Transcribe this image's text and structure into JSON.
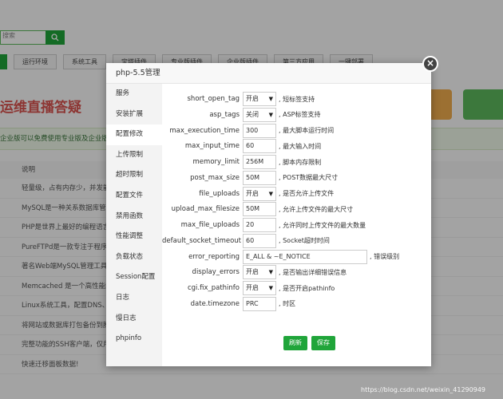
{
  "background": {
    "search_placeholder": "搜索",
    "tabs": [
      "运行环境",
      "系统工具",
      "宝塔插件",
      "专业版插件",
      "企业版插件",
      "第三方应用",
      "一键部署"
    ],
    "banner_text": "运维直播答疑",
    "notice": "企业版可以免费使用专业版及企业版插",
    "list_header": "说明",
    "list_rows": [
      "轻量级，占有内存少，并发能力",
      "MySQL是一种关系数据库管理",
      "PHP是世界上最好的编程语言",
      "PureFTPd是一款专注于程序健",
      "著名Web端MySQL管理工具",
      "Memcached 是一个高性能的分",
      "Linux系统工具，配置DNS、Sw",
      "将网站或数据库打包备份到腾讯",
      "完整功能的SSH客户端，仅用于",
      "快速迁移面板数据!"
    ]
  },
  "dialog": {
    "title": "php-5.5管理",
    "close": "×",
    "sidebar": [
      "服务",
      "安装扩展",
      "配置修改",
      "上传限制",
      "超时限制",
      "配置文件",
      "禁用函数",
      "性能调整",
      "负载状态",
      "Session配置",
      "日志",
      "慢日志",
      "phpinfo"
    ],
    "active_index": 2,
    "rows": [
      {
        "label": "short_open_tag",
        "type": "select",
        "value": "开启",
        "desc": "短标签支持"
      },
      {
        "label": "asp_tags",
        "type": "select",
        "value": "关闭",
        "desc": "ASP标签支持"
      },
      {
        "label": "max_execution_time",
        "type": "input",
        "value": "300",
        "desc": "最大脚本运行时间"
      },
      {
        "label": "max_input_time",
        "type": "input",
        "value": "60",
        "desc": "最大输入时间"
      },
      {
        "label": "memory_limit",
        "type": "input",
        "value": "256M",
        "desc": "脚本内存限制"
      },
      {
        "label": "post_max_size",
        "type": "input",
        "value": "50M",
        "desc": "POST数据最大尺寸"
      },
      {
        "label": "file_uploads",
        "type": "select",
        "value": "开启",
        "desc": "是否允许上传文件"
      },
      {
        "label": "upload_max_filesize",
        "type": "input",
        "value": "50M",
        "desc": "允许上传文件的最大尺寸"
      },
      {
        "label": "max_file_uploads",
        "type": "input",
        "value": "20",
        "desc": "允许同时上传文件的最大数量"
      },
      {
        "label": "default_socket_timeout",
        "type": "input",
        "value": "60",
        "desc": "Socket超时时间"
      },
      {
        "label": "error_reporting",
        "type": "input-wide",
        "value": "E_ALL & ~E_NOTICE",
        "desc": "错误级别"
      },
      {
        "label": "display_errors",
        "type": "select",
        "value": "开启",
        "desc": "是否输出详细错误信息"
      },
      {
        "label": "cgi.fix_pathinfo",
        "type": "select",
        "value": "开启",
        "desc": "是否开启pathinfo"
      },
      {
        "label": "date.timezone",
        "type": "input",
        "value": "PRC",
        "desc": "时区"
      }
    ],
    "refresh_label": "刷新",
    "save_label": "保存"
  },
  "watermark": "https://blog.csdn.net/weixin_41290949"
}
